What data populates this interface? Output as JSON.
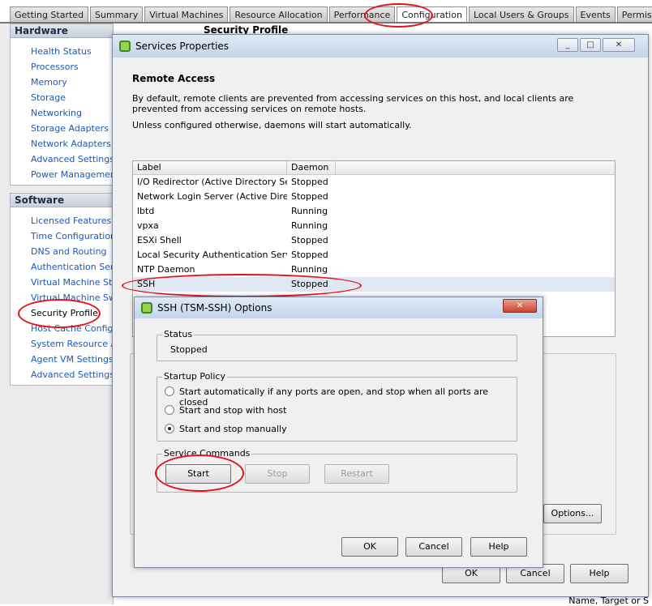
{
  "tabs": [
    "Getting Started",
    "Summary",
    "Virtual Machines",
    "Resource Allocation",
    "Performance",
    "Configuration",
    "Local Users & Groups",
    "Events",
    "Permissions"
  ],
  "active_tab": "Configuration",
  "left": {
    "hardware_title": "Hardware",
    "hardware_items": [
      "Health Status",
      "Processors",
      "Memory",
      "Storage",
      "Networking",
      "Storage Adapters",
      "Network Adapters",
      "Advanced Settings",
      "Power Management"
    ],
    "software_title": "Software",
    "software_items": [
      "Licensed Features",
      "Time Configuration",
      "DNS and Routing",
      "Authentication Services",
      "Virtual Machine Startup",
      "Virtual Machine Swapfile",
      "Security Profile",
      "Host Cache Configuration",
      "System Resource Allocation",
      "Agent VM Settings",
      "Advanced Settings"
    ],
    "selected_item": "Security Profile"
  },
  "main": {
    "security_profile_title": "Security Profile",
    "status_bar_text": "Name, Target or S"
  },
  "services_dialog": {
    "title": "Services Properties",
    "section_title": "Remote Access",
    "desc1": "By default, remote clients are prevented from accessing services on this host, and local clients are prevented from accessing services on remote hosts.",
    "desc2": "Unless configured otherwise, daemons will start automatically.",
    "columns": [
      "Label",
      "Daemon"
    ],
    "rows": [
      {
        "label": "I/O Redirector (Active Directory Se...",
        "daemon": "Stopped"
      },
      {
        "label": "Network Login Server (Active Direc...",
        "daemon": "Stopped"
      },
      {
        "label": "lbtd",
        "daemon": "Running"
      },
      {
        "label": "vpxa",
        "daemon": "Running"
      },
      {
        "label": "ESXi Shell",
        "daemon": "Stopped"
      },
      {
        "label": "Local Security Authentication Serv...",
        "daemon": "Stopped"
      },
      {
        "label": "NTP Daemon",
        "daemon": "Running"
      },
      {
        "label": "SSH",
        "daemon": "Stopped"
      }
    ],
    "options_button": "Options...",
    "ok_button": "OK",
    "cancel_button": "Cancel",
    "help_button": "Help"
  },
  "ssh_dialog": {
    "title": "SSH (TSM-SSH) Options",
    "status_label": "Status",
    "status_value": "Stopped",
    "startup_policy_label": "Startup Policy",
    "policy_options": [
      "Start automatically if any ports are open, and stop when all ports are closed",
      "Start and stop with host",
      "Start and stop manually"
    ],
    "selected_policy": 2,
    "service_commands_label": "Service Commands",
    "start_button": "Start",
    "stop_button": "Stop",
    "restart_button": "Restart",
    "ok_button": "OK",
    "cancel_button": "Cancel",
    "help_button": "Help"
  },
  "colors": {
    "highlight_red": "#e0141a",
    "link_blue": "#1d58b6"
  }
}
